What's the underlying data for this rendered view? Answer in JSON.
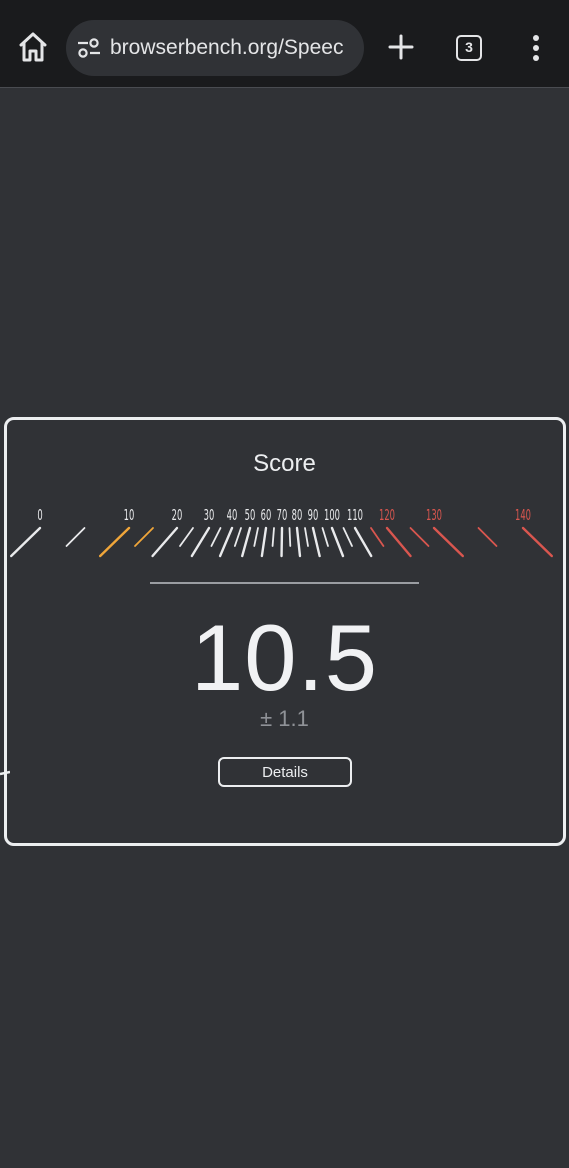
{
  "browser": {
    "url": "browserbench.org/Speec",
    "tab_count": "3",
    "icons": {
      "home": "home-icon",
      "site_settings": "tune-icon",
      "new_tab": "plus-icon",
      "tabs": "tab-count-icon",
      "menu": "more-vert-icon"
    }
  },
  "score_panel": {
    "title": "Score",
    "value": "10.5",
    "error": "± 1.1",
    "details_label": "Details"
  },
  "gauge": {
    "tick_labels": [
      "0",
      "10",
      "20",
      "30",
      "40",
      "50",
      "60",
      "70",
      "80",
      "90",
      "100",
      "110",
      "120",
      "130",
      "140"
    ],
    "current_value": 10.5,
    "colors": {
      "normal": "#e9eaec",
      "active": "#f0a63a",
      "high": "#d9564f"
    }
  }
}
